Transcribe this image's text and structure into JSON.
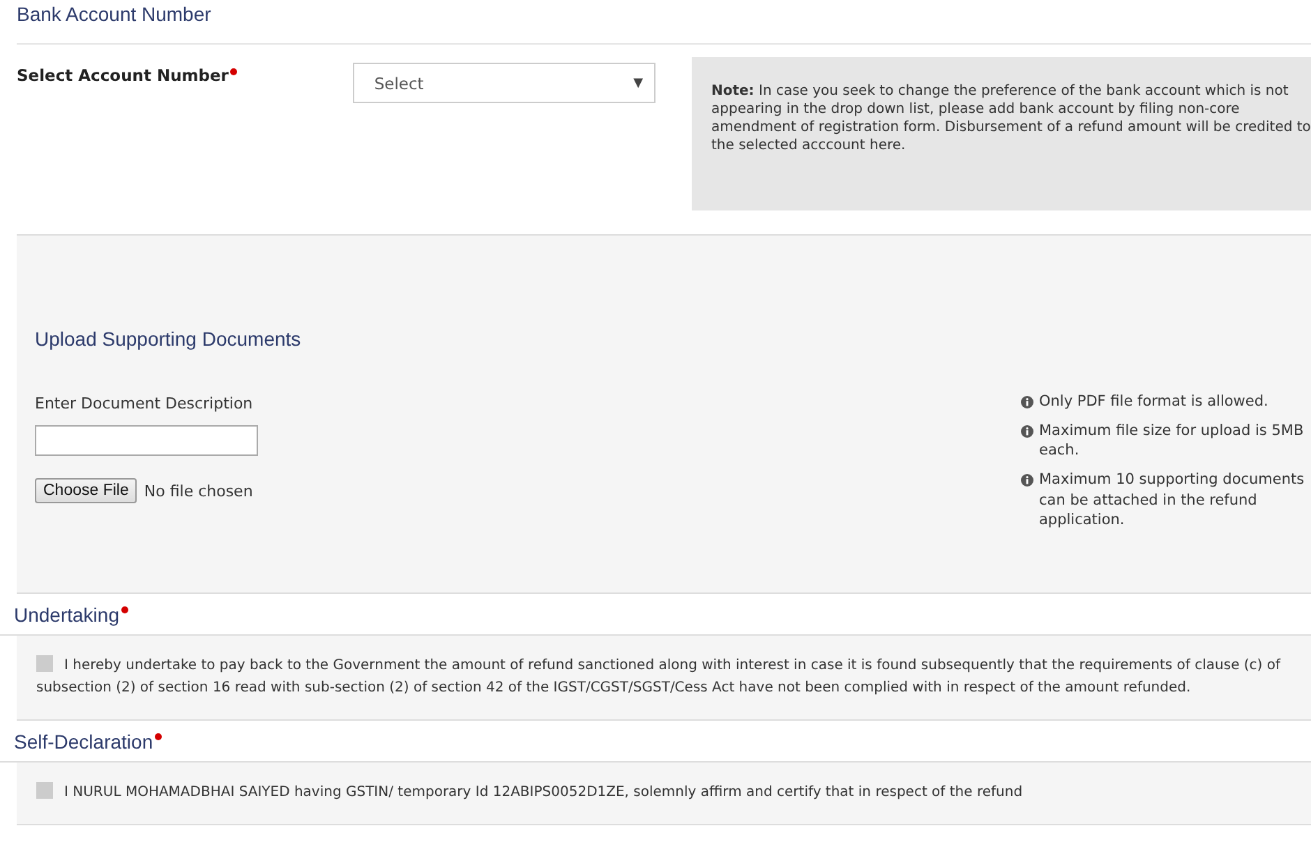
{
  "bank_section": {
    "title": "Bank Account Number",
    "field_label": "Select Account Number",
    "required": true,
    "select": {
      "value": "Select",
      "caret": "▼"
    },
    "note": {
      "label": "Note:",
      "text": "In case you seek to change the preference of the bank account which is not appearing in the drop down list, please add bank account by filing non-core amendment of registration form. Disbursement of a refund amount will be credited to the selected acccount here."
    }
  },
  "upload_section": {
    "title": "Upload Supporting Documents",
    "description_label": "Enter Document Description",
    "choose_file_button": "Choose File",
    "file_status": "No file chosen",
    "info_notes": [
      "Only PDF file format is allowed.",
      "Maximum file size for upload is 5MB each.",
      "Maximum 10 supporting documents can be attached in the refund application."
    ]
  },
  "declarations": [
    {
      "title": "Undertaking",
      "required": true,
      "checked": false,
      "text": "I hereby undertake to pay back to the Government the amount of refund sanctioned along with interest in case it is found subsequently that the requirements of clause (c) of subsection (2) of section 16 read with sub-section (2) of section 42 of the IGST/CGST/SGST/Cess Act have not been complied with in respect of the amount refunded."
    },
    {
      "title": "Self-Declaration",
      "required": true,
      "checked": false,
      "text": "I NURUL MOHAMADBHAI SAIYED having GSTIN/ temporary Id 12ABIPS0052D1ZE, solemnly affirm and certify that in respect of the refund"
    }
  ]
}
